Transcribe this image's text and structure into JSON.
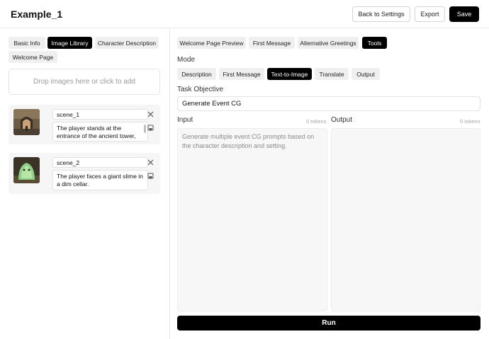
{
  "header": {
    "title": "Example_1",
    "back_label": "Back to Settings",
    "export_label": "Export",
    "save_label": "Save"
  },
  "left_tabs": [
    "Basic Info",
    "Image Library",
    "Character Description",
    "Welcome Page"
  ],
  "left_active_tab": "Image Library",
  "dropzone": {
    "text": "Drop images here or click to add"
  },
  "images": [
    {
      "name": "scene_1",
      "description": "The player stands at the entrance of the ancient tower, gripping"
    },
    {
      "name": "scene_2",
      "description": "The player faces a giant slime in a dim cellar."
    }
  ],
  "right_tabs": [
    "Welcome Page Preview",
    "First Message",
    "Alternative Greetings",
    "Tools"
  ],
  "right_active_tab": "Tools",
  "mode": {
    "label": "Mode",
    "options": [
      "Description",
      "First Message",
      "Text-to-Image",
      "Translate",
      "Output"
    ],
    "active": "Text-to-Image"
  },
  "task": {
    "label": "Task Objective",
    "value": "Generate Event CG"
  },
  "input": {
    "label": "Input",
    "tokens": "0 tokens",
    "value": "Generate multiple event CG prompts based on the character description and setting."
  },
  "output": {
    "label": "Output",
    "tokens": "0 tokens",
    "value": ""
  },
  "run_label": "Run",
  "colors": {
    "accent": "#000000",
    "tab_bg": "#efefef",
    "panel_bg": "#f7f7f7"
  }
}
